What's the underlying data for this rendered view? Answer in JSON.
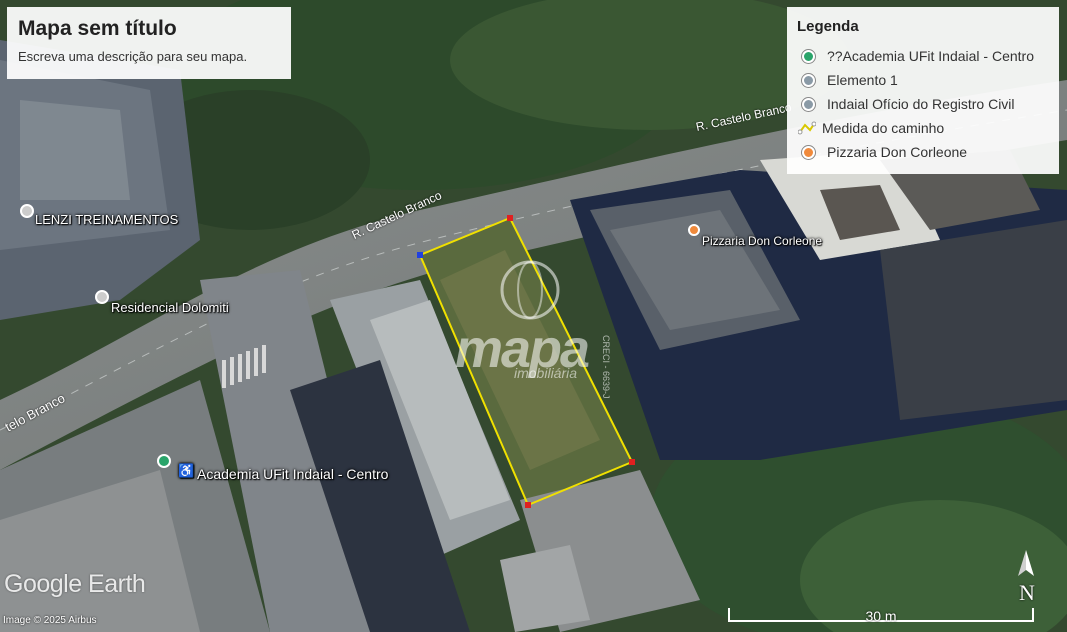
{
  "map": {
    "title": "Mapa sem título",
    "description": "Escreva uma descrição para seu mapa.",
    "pins": [
      {
        "label": "LENZI TREINAMENTOS",
        "color": "#e0e0e0"
      },
      {
        "label": "Residencial Dolomiti",
        "color": "#e0e0e0"
      },
      {
        "label": "Academia UFit Indaial - Centro",
        "color": "#2aa46a"
      },
      {
        "label": "Pizzaria Don Corleone",
        "color": "#f08a3c"
      }
    ],
    "roads": [
      "R. Castelo Branco",
      "R. Castelo Branco",
      "telo Branco"
    ],
    "watermark": {
      "brand": "mapa",
      "sub": "imobiliária",
      "side": "CRECI - 6639-J"
    }
  },
  "legend": {
    "title": "Legenda",
    "items": [
      {
        "label": "??Academia UFit Indaial - Centro",
        "icon": "pin-icon",
        "color": "#2aa46a"
      },
      {
        "label": "Elemento 1",
        "icon": "pin-icon",
        "color": "#8a9aa6"
      },
      {
        "label": "Indaial Ofício do Registro Civil",
        "icon": "pin-icon",
        "color": "#8a9aa6"
      },
      {
        "label": "Medida do caminho",
        "icon": "path-icon",
        "color": "#e8e000"
      },
      {
        "label": "Pizzaria Don Corleone",
        "icon": "pin-icon",
        "color": "#f08a3c"
      }
    ]
  },
  "branding": {
    "logo": "Google Earth",
    "imagery": "Image © 2025 Airbus"
  },
  "scale": {
    "label": "30 m"
  },
  "compass": {
    "label": "N"
  },
  "colors": {
    "measure_line": "#f0e000",
    "vertex": "#e02020",
    "start_vertex": "#2040e0"
  }
}
